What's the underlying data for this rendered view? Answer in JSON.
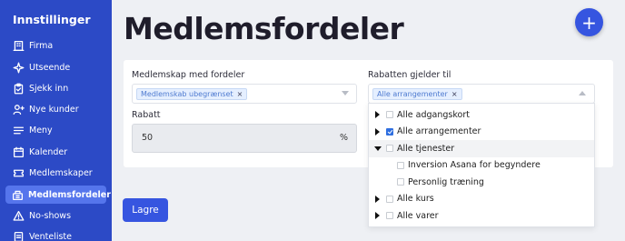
{
  "sidebar": {
    "title": "Innstillinger",
    "items": [
      {
        "label": "Firma",
        "icon": "building-icon"
      },
      {
        "label": "Utseende",
        "icon": "sparkle-icon"
      },
      {
        "label": "Sjekk inn",
        "icon": "clipboard-check-icon"
      },
      {
        "label": "Nye kunder",
        "icon": "user-plus-icon"
      },
      {
        "label": "Meny",
        "icon": "menu-icon"
      },
      {
        "label": "Kalender",
        "icon": "calendar-icon"
      },
      {
        "label": "Medlemskaper",
        "icon": "ticket-icon"
      },
      {
        "label": "Medlemsfordeler",
        "icon": "badge-icon",
        "active": true
      },
      {
        "label": "No-shows",
        "icon": "warning-icon"
      },
      {
        "label": "Venteliste",
        "icon": "list-icon"
      }
    ]
  },
  "page": {
    "title": "Medlemsfordeler",
    "add_button": "+"
  },
  "form": {
    "membership_label": "Medlemskap med fordeler",
    "membership_tag": "Medlemskab ubegrænset",
    "tag_remove": "×",
    "discount_label": "Rabatt",
    "discount_value": "50",
    "discount_unit": "%",
    "applies_label": "Rabatten gjelder til",
    "applies_tag": "Alle arrangementer",
    "save_label": "Lagre"
  },
  "dropdown": {
    "options": [
      {
        "label": "Alle adgangskort",
        "expander": "collapsed",
        "checked": false,
        "level": 0
      },
      {
        "label": "Alle arrangementer",
        "expander": "collapsed",
        "checked": true,
        "level": 0
      },
      {
        "label": "Alle tjenester",
        "expander": "expanded",
        "checked": false,
        "level": 0,
        "highlighted": true
      },
      {
        "label": "Inversion Asana for begyndere",
        "expander": "none",
        "checked": false,
        "level": 1
      },
      {
        "label": "Personlig træning",
        "expander": "none",
        "checked": false,
        "level": 1
      },
      {
        "label": "Alle kurs",
        "expander": "collapsed",
        "checked": false,
        "level": 0
      },
      {
        "label": "Alle varer",
        "expander": "collapsed",
        "checked": false,
        "level": 0
      }
    ]
  },
  "colors": {
    "sidebar": "#2c4ac6",
    "sidebar_active": "#5575ec",
    "accent": "#3655e0",
    "background": "#eef0f4"
  }
}
